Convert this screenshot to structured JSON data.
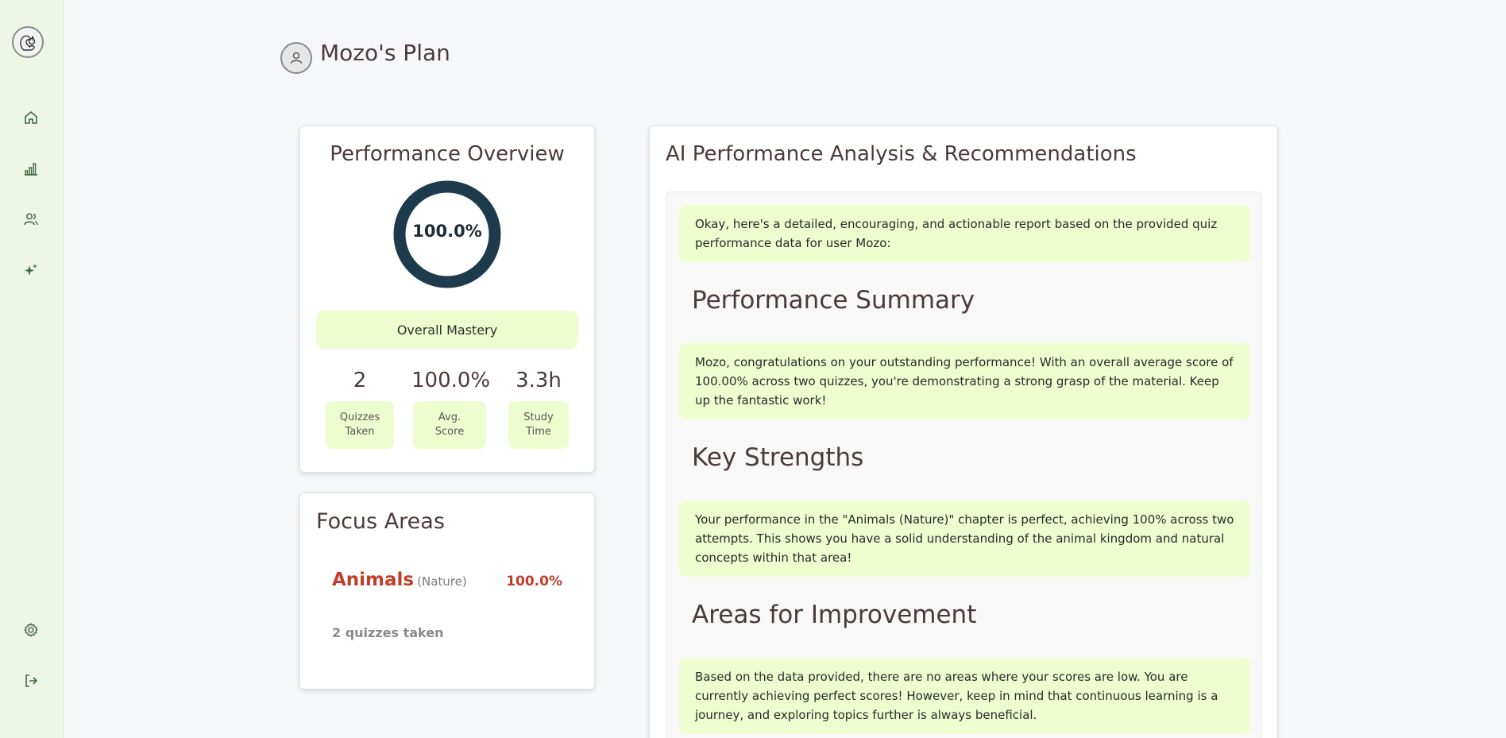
{
  "sidebar": {
    "items": [
      {
        "icon": "home-icon"
      },
      {
        "icon": "bar-chart-icon"
      },
      {
        "icon": "users-icon"
      },
      {
        "icon": "sparkles-icon"
      }
    ],
    "bottom": [
      {
        "icon": "gear-icon"
      },
      {
        "icon": "logout-icon"
      }
    ]
  },
  "header": {
    "title": "Mozo's Plan"
  },
  "performance": {
    "title": "Performance Overview",
    "mastery_percent": "100.0%",
    "mastery_fraction": 1.0,
    "mastery_label": "Overall Mastery",
    "stats": [
      {
        "value": "2",
        "label_line1": "Quizzes",
        "label_line2": "Taken"
      },
      {
        "value": "100.0%",
        "label_line1": "Avg.",
        "label_line2": "Score"
      },
      {
        "value": "3.3h",
        "label_line1": "Study",
        "label_line2": "Time"
      }
    ]
  },
  "focus": {
    "title": "Focus Areas",
    "topic": "Animals",
    "topic_sub": "(Nature)",
    "score": "100.0%",
    "count": "2 quizzes taken"
  },
  "ai": {
    "title": "AI Performance Analysis & Recommendations",
    "intro": "Okay, here's a detailed, encouraging, and actionable report based on the provided quiz performance data for user Mozo:",
    "summary_heading": "Performance Summary",
    "summary_text": "Mozo, congratulations on your outstanding performance! With an overall average score of 100.00% across two quizzes, you're demonstrating a strong grasp of the material. Keep up the fantastic work!",
    "strengths_heading": "Key Strengths",
    "strengths_text": "Your performance in the \"Animals (Nature)\" chapter is perfect, achieving 100% across two attempts. This shows you have a solid understanding of the animal kingdom and natural concepts within that area!",
    "improvement_heading": "Areas for Improvement",
    "improvement_text": "Based on the data provided, there are no areas where your scores are low. You are currently achieving perfect scores! However, keep in mind that continuous learning is a journey, and exploring topics further is always beneficial."
  },
  "colors": {
    "accent_green": "#eefdd0",
    "ring_color": "#1e3a4d",
    "sidebar_bg": "#eef6e6",
    "focus_red": "#c43d2a",
    "icon_green": "#3e6b3e"
  }
}
